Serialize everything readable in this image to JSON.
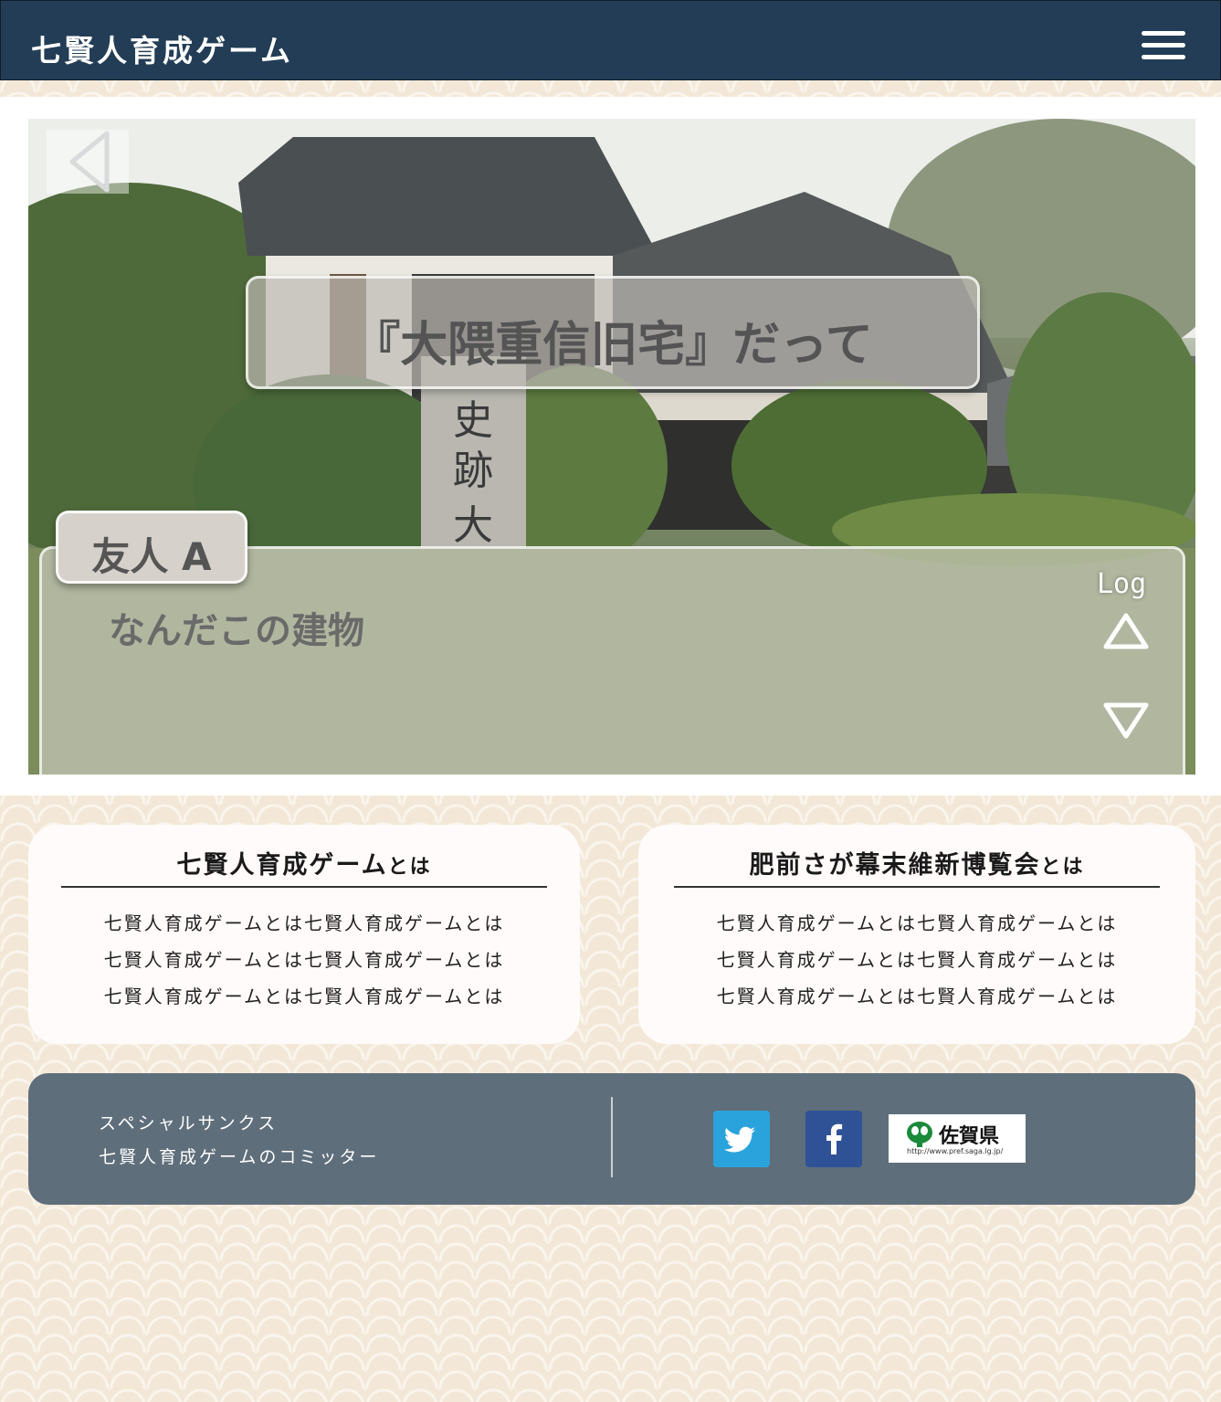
{
  "header": {
    "title": "七賢人育成ゲーム",
    "menu_icon": "hamburger-menu-icon"
  },
  "game": {
    "caption": "『大隈重信旧宅』だって",
    "speaker": "友人 A",
    "dialog": "なんだこの建物",
    "log_label": "Log",
    "icons": [
      "back-arrow-icon",
      "scroll-up-icon",
      "scroll-down-icon"
    ]
  },
  "cards": [
    {
      "title_main": "七賢人育成ゲーム",
      "title_suffix": "とは",
      "lines": [
        "七賢人育成ゲームとは七賢人育成ゲームとは",
        "七賢人育成ゲームとは七賢人育成ゲームとは",
        "七賢人育成ゲームとは七賢人育成ゲームとは"
      ]
    },
    {
      "title_main": "肥前さが幕末維新博覧会",
      "title_suffix": "とは",
      "lines": [
        "七賢人育成ゲームとは七賢人育成ゲームとは",
        "七賢人育成ゲームとは七賢人育成ゲームとは",
        "七賢人育成ゲームとは七賢人育成ゲームとは"
      ]
    }
  ],
  "footer": {
    "line1": "スペシャルサンクス",
    "line2": "七賢人育成ゲームのコミッター",
    "saga_name": "佐賀県",
    "saga_url": "http://www.pref.saga.lg.jp/",
    "icons": [
      "twitter-icon",
      "facebook-icon",
      "saga-prefecture-logo"
    ]
  },
  "colors": {
    "header_bg": "#233d56",
    "footer_bg": "#5f6e7b",
    "page_bg": "#f3e8d7",
    "twitter": "#2aa3dc",
    "facebook": "#2f5297"
  }
}
